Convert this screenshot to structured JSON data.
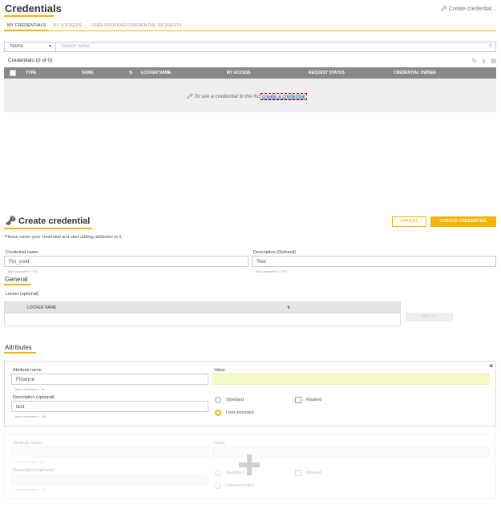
{
  "header": {
    "title": "Credentials",
    "top_create_link": "Create credential..."
  },
  "tabs": [
    {
      "label": "MY CREDENTIALS",
      "active": true
    },
    {
      "label": "MY LOCKERS",
      "active": false
    },
    {
      "label": "USER-PROVIDED CREDENTIAL REQUESTS",
      "active": false
    }
  ],
  "filter": {
    "select_value": "Name",
    "search_placeholder": "Search name"
  },
  "list": {
    "count_label": "Credentials (0 of 0)",
    "columns": [
      "TYPE",
      "NAME",
      "LOCKER NAME",
      "MY ACCESS",
      "REQUEST STATUS",
      "CREDENTIAL OWNER"
    ],
    "empty_message": "To see a credential in the list",
    "empty_link": "create a credential"
  },
  "create_form": {
    "title": "Create credential",
    "cancel_label": "CANCEL",
    "create_label": "CREATE CREDENTIAL",
    "intro": "Please name your credential and start adding attributes to it.",
    "credential_name": {
      "label": "Credential name",
      "value": "Fin_cred",
      "hint": "Max characters = 50"
    },
    "description": {
      "label": "Description (Optional)",
      "value": "Test",
      "hint": "Max characters = 255"
    },
    "general": {
      "title": "General",
      "locker_label": "Locker (optional)",
      "locker_column": "LOCKER NAME",
      "add_label": "ADD >>"
    },
    "attributes": {
      "title": "Attributes",
      "items": [
        {
          "name_label": "Attribute name",
          "name_value": "Finance",
          "name_hint": "Max characters = 50",
          "desc_label": "Description (optional)",
          "desc_value": "test",
          "desc_hint": "Max characters = 255",
          "value_label": "Value",
          "opt_standard": "Standard",
          "opt_user": "User-provided",
          "opt_masked": "Masked",
          "selected": "User-provided"
        },
        {
          "name_label": "Attribute name",
          "name_hint": "Max characters = 50",
          "desc_label": "Description (optional)",
          "desc_hint": "Max characters = 255",
          "value_label": "Value",
          "opt_standard": "Standard",
          "opt_user": "User-provided",
          "opt_masked": "Masked"
        }
      ]
    }
  },
  "colors": {
    "accent": "#f5b400",
    "table_header": "#888888",
    "value_highlight": "#f7f9c3",
    "link": "#1a4fa0"
  }
}
